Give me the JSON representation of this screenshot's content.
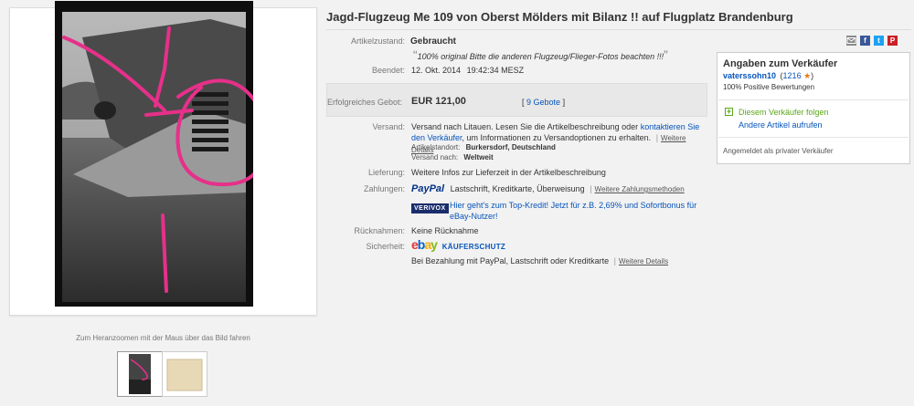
{
  "title": "Jagd-Flugzeug Me 109 von Oberst Mölders mit Bilanz !! auf Flugplatz Brandenburg",
  "gallery": {
    "zoom_hint": "Zum Heranzoomen mit der Maus über das Bild fahren"
  },
  "condition": {
    "label": "Artikelzustand:",
    "value": "Gebraucht",
    "note_open": "“",
    "note": "100% original Bitte die anderen Flugzeug/Flieger-Fotos beachten !!!",
    "note_close": "”"
  },
  "ended": {
    "label": "Beendet:",
    "date": "12. Okt. 2014",
    "time": "19:42:34 MESZ"
  },
  "bid": {
    "label": "Erfolgreiches Gebot:",
    "price": "EUR 121,00",
    "count_open": "[",
    "count": "9 Gebote",
    "count_close": "]"
  },
  "shipping": {
    "label": "Versand:",
    "text": "Versand nach Litauen. Lesen Sie die Artikelbeschreibung oder",
    "contact_link_1": "kontaktieren Sie",
    "contact_link_2": "den Verkäufer",
    "text2": ", um Informationen zu Versandoptionen zu erhalten.",
    "pipe": "|",
    "details": "Weitere Details",
    "location_label": "Artikelstandort:",
    "location": "Burkersdorf, Deutschland",
    "ships_to_label": "Versand nach:",
    "ships_to": "Weltweit"
  },
  "delivery": {
    "label": "Lieferung:",
    "value": "Weitere Infos zur Lieferzeit in der Artikelbeschreibung"
  },
  "payments": {
    "label": "Zahlungen:",
    "logo": "PayPal",
    "methods": "Lastschrift,  Kreditkarte,  Überweisung",
    "pipe": "|",
    "more": "Weitere Zahlungsmethoden",
    "verivox": "VERIVOX",
    "credit_line1": "Hier geht's zum Top-Kredit! Jetzt für z.B. 2,69% und Sofortbonus für",
    "credit_line2": "eBay-Nutzer!"
  },
  "returns": {
    "label": "Rücknahmen:",
    "value": "Keine Rücknahme"
  },
  "security": {
    "label": "Sicherheit:",
    "ebay_e": "e",
    "ebay_b": "b",
    "ebay_a": "a",
    "ebay_y": "y",
    "protection": "KÄUFERSCHUTZ",
    "text": "Bei Bezahlung mit PayPal, Lastschrift oder Kreditkarte",
    "pipe": "|",
    "details": "Weitere Details"
  },
  "share": {
    "icons": [
      "mail-icon",
      "facebook-icon",
      "twitter-icon",
      "pinterest-icon"
    ],
    "fb": "f",
    "tw": "t",
    "pin": "P"
  },
  "seller": {
    "heading": "Angaben zum Verkäufer",
    "name": "vaterssohn10",
    "score_open": "(",
    "score": "1216",
    "score_close": ")",
    "positive": "100% Positive Bewertungen",
    "follow": "Diesem Verkäufer folgen",
    "other": "Andere Artikel aufrufen",
    "registered": "Angemeldet als privater Verkäufer"
  },
  "colors": {
    "ebay_e": "#e53238",
    "ebay_b": "#0064d2",
    "ebay_a": "#f5af02",
    "ebay_y": "#86b817",
    "link": "#0654ba",
    "follow": "#5ba71b",
    "star": "#e8761a"
  }
}
